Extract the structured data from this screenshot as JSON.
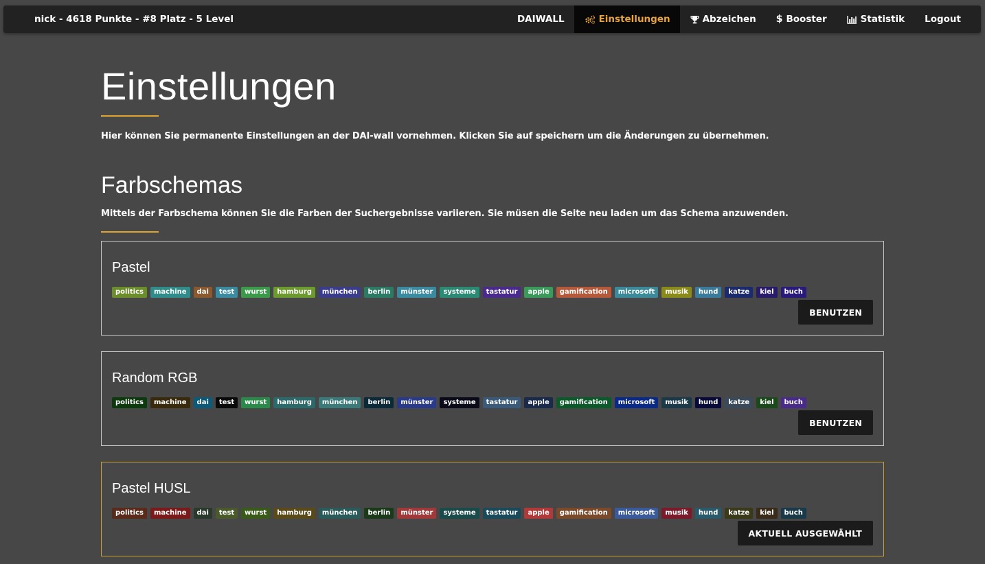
{
  "navbar": {
    "brand": "nick - 4618 Punkte - #8 Platz - 5 Level",
    "items": [
      {
        "label": "DAIWALL",
        "icon": ""
      },
      {
        "label": "Einstellungen",
        "icon": "cogs-icon"
      },
      {
        "label": "Abzeichen",
        "icon": "trophy-icon"
      },
      {
        "label": "Booster",
        "icon": "dollar-icon"
      },
      {
        "label": "Statistik",
        "icon": "bar-chart-icon"
      },
      {
        "label": "Logout",
        "icon": ""
      }
    ],
    "active_color": "#e8a33d"
  },
  "page": {
    "title": "Einstellungen",
    "intro": "Hier können Sie permanente Einstellungen an der DAI-wall vornehmen. Klicken Sie auf speichern um die Änderungen zu übernehmen.",
    "section_title": "Farbschemas",
    "section_text": "Mittels der Farbschema können Sie die Farben der Suchergebnisse variieren. Sie müsen die Seite neu laden um das Schema anzuwenden."
  },
  "tags": [
    "politics",
    "machine",
    "dai",
    "test",
    "wurst",
    "hamburg",
    "münchen",
    "berlin",
    "münster",
    "systeme",
    "tastatur",
    "apple",
    "gamification",
    "microsoft",
    "musik",
    "hund",
    "katze",
    "kiel",
    "buch"
  ],
  "schemes": [
    {
      "name": "Pastel",
      "button": "BENUTZEN",
      "selected": false,
      "colors": [
        "#6b8d2a",
        "#2f8c8a",
        "#8a5a2e",
        "#3a8aa0",
        "#3a9a4a",
        "#6c9a2e",
        "#3c3c8c",
        "#2a7a64",
        "#3a8aa0",
        "#2a8a74",
        "#4a2a8c",
        "#3a9a5a",
        "#b45a3a",
        "#3a8a9a",
        "#8a8a1a",
        "#3a7a9a",
        "#1a2a6c",
        "#2a1a6c",
        "#2a1a7c"
      ]
    },
    {
      "name": "Random RGB",
      "button": "BENUTZEN",
      "selected": false,
      "colors": [
        "#0c3a0c",
        "#3a2a0c",
        "#0c5a7a",
        "#0a0a0a",
        "#2a8a4a",
        "#2a6a6a",
        "#3a7a7a",
        "#0a2a3a",
        "#2a3a8a",
        "#0a0a1a",
        "#3a5a7a",
        "#1a2a4a",
        "#0a5a2a",
        "#0a2a8a",
        "#1a3a4a",
        "#0a0a3a",
        "#3a4a5a",
        "#1a4a1a",
        "#4a2a8a"
      ]
    },
    {
      "name": "Pastel HUSL",
      "button": "AKTUELL AUSGEWÄHLT",
      "selected": true,
      "colors": [
        "#5a2a1a",
        "#7a1a1a",
        "#2a3a2a",
        "#4a5a2a",
        "#3a5a1a",
        "#5a4a1a",
        "#2a5a5a",
        "#1a3a1a",
        "#a03a3a",
        "#1a4a4a",
        "#1a4a5a",
        "#b03a3a",
        "#7a4a2a",
        "#3a5a9a",
        "#7a1a2a",
        "#2a5a6a",
        "#3a3a1a",
        "#3a2a1a",
        "#1a3a4a"
      ]
    }
  ]
}
